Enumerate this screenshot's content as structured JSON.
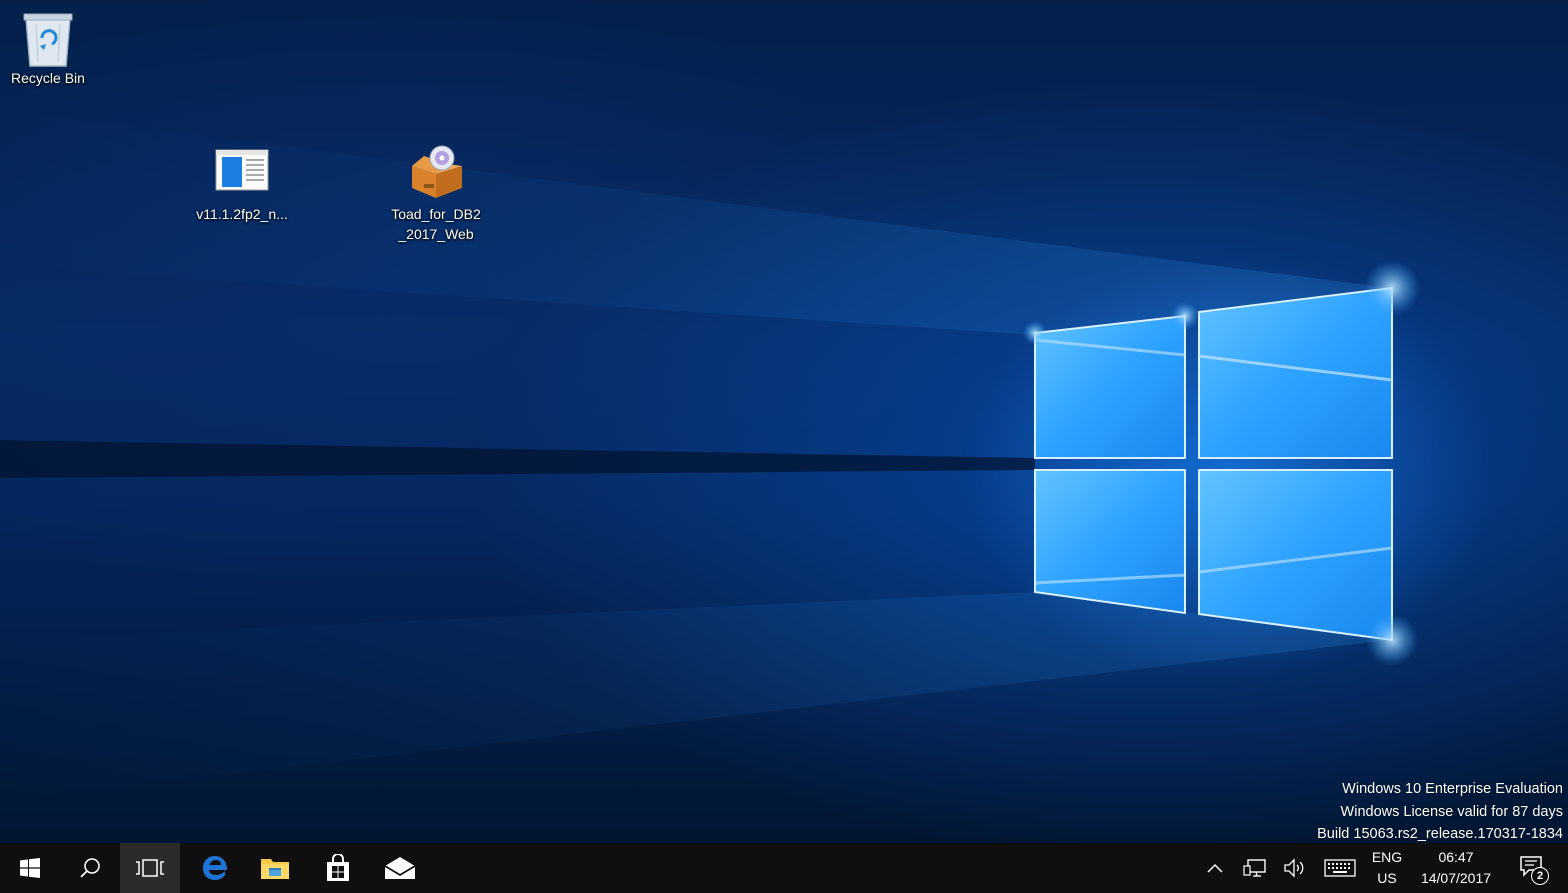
{
  "desktop": {
    "icons": [
      {
        "label": "Recycle Bin",
        "icon": "recycle-bin-icon"
      },
      {
        "label": "v11.1.2fp2_n...",
        "icon": "document-window-icon"
      },
      {
        "label": "Toad_for_DB2\n_2017_Web",
        "icon": "installer-box-icon"
      }
    ]
  },
  "watermark": {
    "line1": "Windows 10 Enterprise Evaluation",
    "line2": "Windows License valid for 87 days",
    "line3": "Build 15063.rs2_release.170317-1834"
  },
  "taskbar": {
    "buttons": [
      {
        "icon": "windows-start-icon"
      },
      {
        "icon": "search-icon"
      },
      {
        "icon": "task-view-icon"
      },
      {
        "icon": "edge-browser-icon"
      },
      {
        "icon": "file-explorer-icon"
      },
      {
        "icon": "store-icon"
      },
      {
        "icon": "mail-icon"
      }
    ],
    "tray": {
      "chevron_icon": "chevron-up-icon",
      "network_icon": "network-icon",
      "volume_icon": "volume-icon",
      "keyboard_icon": "touch-keyboard-icon",
      "lang_top": "ENG",
      "lang_bottom": "US",
      "time": "06:47",
      "date": "14/07/2017",
      "notification_count": "2"
    }
  },
  "colors": {
    "taskbar_bg": "#0f0f0f",
    "accent": "#1a8cff",
    "edge_blue": "#1e74d6",
    "explorer_yellow": "#f7c948"
  }
}
